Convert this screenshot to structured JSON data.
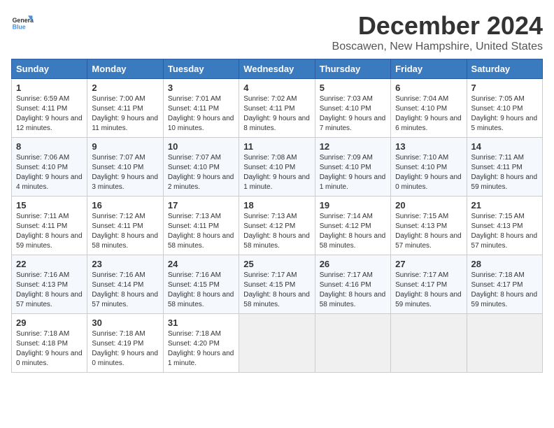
{
  "logo": {
    "line1": "General",
    "line2": "Blue"
  },
  "title": "December 2024",
  "subtitle": "Boscawen, New Hampshire, United States",
  "headers": [
    "Sunday",
    "Monday",
    "Tuesday",
    "Wednesday",
    "Thursday",
    "Friday",
    "Saturday"
  ],
  "weeks": [
    [
      {
        "day": "1",
        "sunrise": "6:59 AM",
        "sunset": "4:11 PM",
        "daylight": "9 hours and 12 minutes."
      },
      {
        "day": "2",
        "sunrise": "7:00 AM",
        "sunset": "4:11 PM",
        "daylight": "9 hours and 11 minutes."
      },
      {
        "day": "3",
        "sunrise": "7:01 AM",
        "sunset": "4:11 PM",
        "daylight": "9 hours and 10 minutes."
      },
      {
        "day": "4",
        "sunrise": "7:02 AM",
        "sunset": "4:11 PM",
        "daylight": "9 hours and 8 minutes."
      },
      {
        "day": "5",
        "sunrise": "7:03 AM",
        "sunset": "4:10 PM",
        "daylight": "9 hours and 7 minutes."
      },
      {
        "day": "6",
        "sunrise": "7:04 AM",
        "sunset": "4:10 PM",
        "daylight": "9 hours and 6 minutes."
      },
      {
        "day": "7",
        "sunrise": "7:05 AM",
        "sunset": "4:10 PM",
        "daylight": "9 hours and 5 minutes."
      }
    ],
    [
      {
        "day": "8",
        "sunrise": "7:06 AM",
        "sunset": "4:10 PM",
        "daylight": "9 hours and 4 minutes."
      },
      {
        "day": "9",
        "sunrise": "7:07 AM",
        "sunset": "4:10 PM",
        "daylight": "9 hours and 3 minutes."
      },
      {
        "day": "10",
        "sunrise": "7:07 AM",
        "sunset": "4:10 PM",
        "daylight": "9 hours and 2 minutes."
      },
      {
        "day": "11",
        "sunrise": "7:08 AM",
        "sunset": "4:10 PM",
        "daylight": "9 hours and 1 minute."
      },
      {
        "day": "12",
        "sunrise": "7:09 AM",
        "sunset": "4:10 PM",
        "daylight": "9 hours and 1 minute."
      },
      {
        "day": "13",
        "sunrise": "7:10 AM",
        "sunset": "4:10 PM",
        "daylight": "9 hours and 0 minutes."
      },
      {
        "day": "14",
        "sunrise": "7:11 AM",
        "sunset": "4:11 PM",
        "daylight": "8 hours and 59 minutes."
      }
    ],
    [
      {
        "day": "15",
        "sunrise": "7:11 AM",
        "sunset": "4:11 PM",
        "daylight": "8 hours and 59 minutes."
      },
      {
        "day": "16",
        "sunrise": "7:12 AM",
        "sunset": "4:11 PM",
        "daylight": "8 hours and 58 minutes."
      },
      {
        "day": "17",
        "sunrise": "7:13 AM",
        "sunset": "4:11 PM",
        "daylight": "8 hours and 58 minutes."
      },
      {
        "day": "18",
        "sunrise": "7:13 AM",
        "sunset": "4:12 PM",
        "daylight": "8 hours and 58 minutes."
      },
      {
        "day": "19",
        "sunrise": "7:14 AM",
        "sunset": "4:12 PM",
        "daylight": "8 hours and 58 minutes."
      },
      {
        "day": "20",
        "sunrise": "7:15 AM",
        "sunset": "4:13 PM",
        "daylight": "8 hours and 57 minutes."
      },
      {
        "day": "21",
        "sunrise": "7:15 AM",
        "sunset": "4:13 PM",
        "daylight": "8 hours and 57 minutes."
      }
    ],
    [
      {
        "day": "22",
        "sunrise": "7:16 AM",
        "sunset": "4:13 PM",
        "daylight": "8 hours and 57 minutes."
      },
      {
        "day": "23",
        "sunrise": "7:16 AM",
        "sunset": "4:14 PM",
        "daylight": "8 hours and 57 minutes."
      },
      {
        "day": "24",
        "sunrise": "7:16 AM",
        "sunset": "4:15 PM",
        "daylight": "8 hours and 58 minutes."
      },
      {
        "day": "25",
        "sunrise": "7:17 AM",
        "sunset": "4:15 PM",
        "daylight": "8 hours and 58 minutes."
      },
      {
        "day": "26",
        "sunrise": "7:17 AM",
        "sunset": "4:16 PM",
        "daylight": "8 hours and 58 minutes."
      },
      {
        "day": "27",
        "sunrise": "7:17 AM",
        "sunset": "4:17 PM",
        "daylight": "8 hours and 59 minutes."
      },
      {
        "day": "28",
        "sunrise": "7:18 AM",
        "sunset": "4:17 PM",
        "daylight": "8 hours and 59 minutes."
      }
    ],
    [
      {
        "day": "29",
        "sunrise": "7:18 AM",
        "sunset": "4:18 PM",
        "daylight": "9 hours and 0 minutes."
      },
      {
        "day": "30",
        "sunrise": "7:18 AM",
        "sunset": "4:19 PM",
        "daylight": "9 hours and 0 minutes."
      },
      {
        "day": "31",
        "sunrise": "7:18 AM",
        "sunset": "4:20 PM",
        "daylight": "9 hours and 1 minute."
      },
      null,
      null,
      null,
      null
    ]
  ]
}
